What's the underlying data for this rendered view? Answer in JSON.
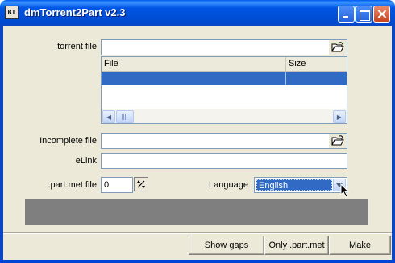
{
  "window": {
    "title": "dmTorrent2Part v2.3",
    "icon_text": "BT"
  },
  "form": {
    "torrent_label": ".torrent file",
    "torrent_value": "",
    "incomplete_label": "Incomplete file",
    "incomplete_value": "",
    "elink_label": "eLink",
    "elink_value": "",
    "partmet_label": ".part.met file",
    "partmet_value": "0",
    "language_label": "Language",
    "language_value": "English"
  },
  "files_table": {
    "columns": [
      "File",
      "Size"
    ],
    "rows": [
      {
        "file": "",
        "size": ""
      }
    ]
  },
  "buttons": {
    "show_gaps": "Show gaps",
    "only_partmet": "Only .part.met",
    "make": "Make"
  },
  "colors": {
    "selection": "#316ac5",
    "face": "#ece9d8",
    "progress": "#7f7f7f"
  }
}
